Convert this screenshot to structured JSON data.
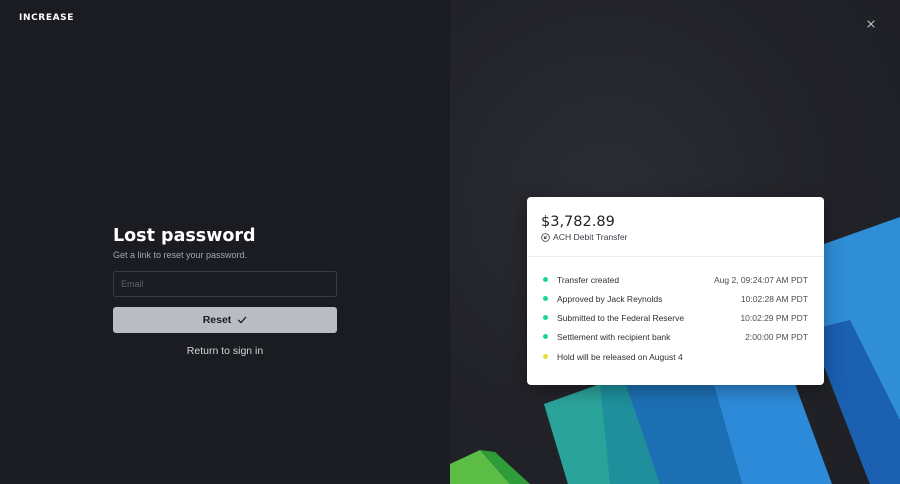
{
  "brand": {
    "logo_text": "INCREASE"
  },
  "form": {
    "title": "Lost password",
    "subtitle": "Get a link to reset your password.",
    "email_placeholder": "Email",
    "email_value": "",
    "reset_label": "Reset",
    "return_label": "Return to sign in"
  },
  "card": {
    "amount": "$3,782.89",
    "transfer_type": "ACH Debit Transfer",
    "events": [
      {
        "label": "Transfer created",
        "time": "Aug 2, 09:24:07 AM PDT",
        "status_color": "#1fd3a0"
      },
      {
        "label": "Approved by Jack Reynolds",
        "time": "10:02:28 AM PDT",
        "status_color": "#1fd3a0"
      },
      {
        "label": "Submitted to the Federal Reserve",
        "time": "10:02:29 PM PDT",
        "status_color": "#1fd3a0"
      },
      {
        "label": "Settlement with recipient bank",
        "time": "2:00:00 PM PDT",
        "status_color": "#1fd3a0"
      },
      {
        "label": "Hold will be released on August 4",
        "time": "",
        "status_color": "#e4dd3a"
      }
    ]
  },
  "icons": {
    "close": "close-icon",
    "check": "check-icon",
    "transfer": "transfer-direction-icon"
  },
  "colors": {
    "background": "#1b1c21",
    "button": "#b9bcc2",
    "complete_dot": "#1fd3a0",
    "pending_dot": "#e4dd3a"
  }
}
